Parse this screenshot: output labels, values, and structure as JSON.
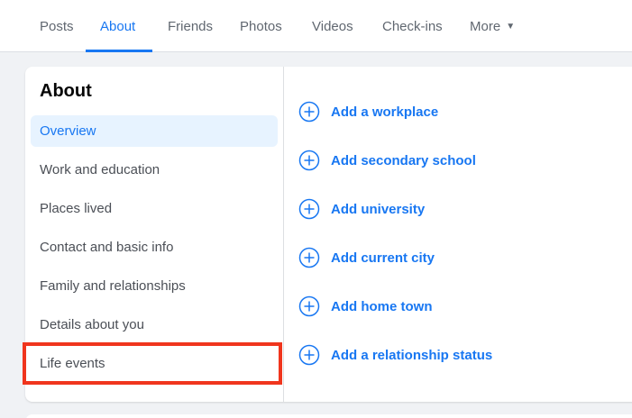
{
  "tabs": [
    {
      "label": "Posts",
      "active": false
    },
    {
      "label": "About",
      "active": true
    },
    {
      "label": "Friends",
      "active": false
    },
    {
      "label": "Photos",
      "active": false
    },
    {
      "label": "Videos",
      "active": false
    },
    {
      "label": "Check-ins",
      "active": false
    },
    {
      "label": "More",
      "active": false
    }
  ],
  "about": {
    "title": "About",
    "sidebar": [
      {
        "label": "Overview",
        "selected": true
      },
      {
        "label": "Work and education"
      },
      {
        "label": "Places lived"
      },
      {
        "label": "Contact and basic info"
      },
      {
        "label": "Family and relationships"
      },
      {
        "label": "Details about you"
      },
      {
        "label": "Life events"
      }
    ],
    "actions": [
      {
        "label": "Add a workplace",
        "icon": "plus-circle-icon"
      },
      {
        "label": "Add secondary school",
        "icon": "plus-circle-icon"
      },
      {
        "label": "Add university",
        "icon": "plus-circle-icon"
      },
      {
        "label": "Add current city",
        "icon": "plus-circle-icon"
      },
      {
        "label": "Add home town",
        "icon": "plus-circle-icon"
      },
      {
        "label": "Add a relationship status",
        "icon": "plus-circle-icon"
      }
    ]
  },
  "colors": {
    "accent": "#1877f2",
    "highlight": "#f0351d",
    "selected_bg": "#e7f3ff",
    "page_bg": "#f0f2f5"
  }
}
